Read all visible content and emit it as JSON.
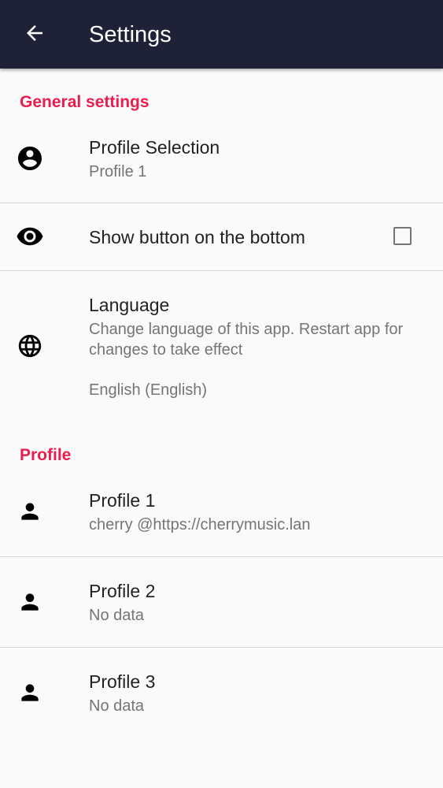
{
  "appbar": {
    "title": "Settings",
    "back_icon": "arrow-back-icon",
    "background": "#1f2236"
  },
  "accent_color": "#e91e4f",
  "general": {
    "header": "General settings",
    "profile_selection": {
      "icon": "account-circle-icon",
      "title": "Profile Selection",
      "summary": "Profile 1"
    },
    "show_button": {
      "icon": "eye-icon",
      "title": "Show button on the bottom",
      "checked": false
    },
    "language": {
      "icon": "globe-icon",
      "title": "Language",
      "summary": "Change language of this app. Restart app for changes to take effect",
      "value": "English (English)"
    }
  },
  "profile": {
    "header": "Profile",
    "items": [
      {
        "icon": "person-icon",
        "title": "Profile 1",
        "summary": "cherry @https://cherrymusic.lan"
      },
      {
        "icon": "person-icon",
        "title": "Profile 2",
        "summary": "No data"
      },
      {
        "icon": "person-icon",
        "title": "Profile 3",
        "summary": "No data"
      }
    ]
  }
}
